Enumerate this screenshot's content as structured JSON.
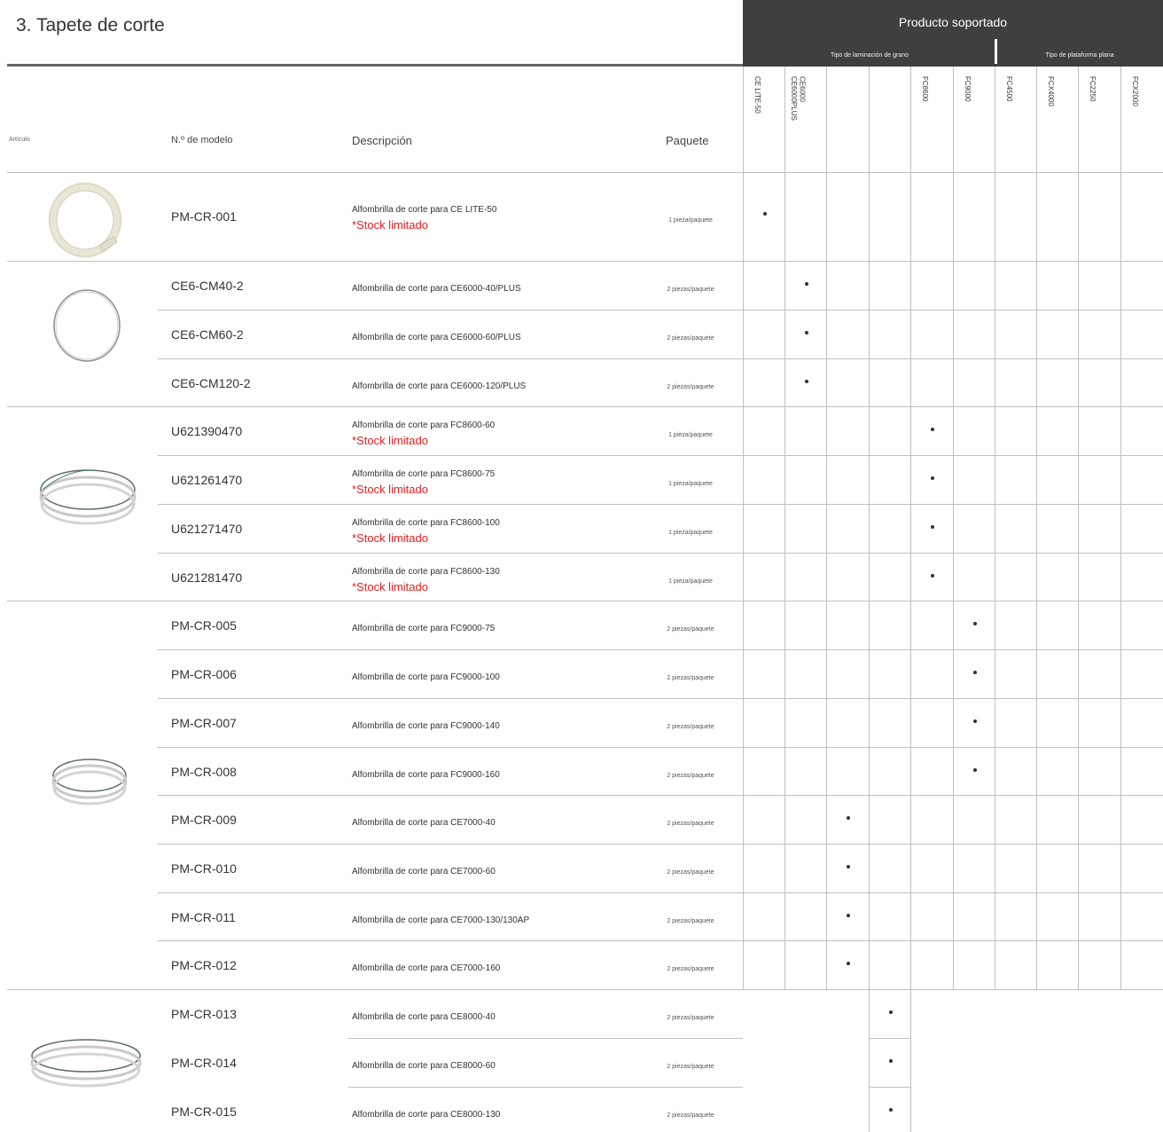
{
  "section_title": "3. Tapete de corte",
  "supported_header": {
    "title": "Producto soportado",
    "grain_label": "Tipo de laminación de grano",
    "flat_label": "Tipo de plataforma plana"
  },
  "columns": {
    "item": "Artículo",
    "model": "N.º de modelo",
    "description": "Descripción",
    "package": "Paquete"
  },
  "products": [
    "CE LITE-50",
    "CE6000\nCE6000PLUS",
    "",
    "",
    "FC8600",
    "FC9000",
    "FC4500",
    "FCX4000",
    "FC2250",
    "FCX2000"
  ],
  "product_labels": [
    "CE LITE-50",
    "CE6000 CE6000PLUS",
    "",
    "",
    "FC8600",
    "FC9000",
    "FC4500",
    "FCX4000",
    "FC2250",
    "FCX2000"
  ],
  "rows": [
    {
      "model": "PM-CR-001",
      "desc": "Alfombrilla de corte para CE LITE-50",
      "note": "*Stock limitado",
      "pack": "1 pieza/paquete",
      "col": 0
    },
    {
      "model": "CE6-CM40-2",
      "desc": "Alfombrilla de corte para CE6000-40/PLUS",
      "note": "",
      "pack": "2 piezas/paquete",
      "col": 1
    },
    {
      "model": "CE6-CM60-2",
      "desc": "Alfombrilla de corte para CE6000-60/PLUS",
      "note": "",
      "pack": "2 piezas/paquete",
      "col": 1
    },
    {
      "model": "CE6-CM120-2",
      "desc": "Alfombrilla de corte para CE6000-120/PLUS",
      "note": "",
      "pack": "2 piezas/paquete",
      "col": 1
    },
    {
      "model": "U621390470",
      "desc": "Alfombrilla de corte para FC8600-60",
      "note": "*Stock limitado",
      "pack": "1 pieza/paquete",
      "col": 4
    },
    {
      "model": "U621261470",
      "desc": "Alfombrilla de corte para FC8600-75",
      "note": "*Stock limitado",
      "pack": "1 pieza/paquete",
      "col": 4
    },
    {
      "model": "U621271470",
      "desc": "Alfombrilla de corte para FC8600-100",
      "note": "*Stock limitado",
      "pack": "1 pieza/paquete",
      "col": 4
    },
    {
      "model": "U621281470",
      "desc": "Alfombrilla de corte para FC8600-130",
      "note": "*Stock limitado",
      "pack": "1 pieza/paquete",
      "col": 4
    },
    {
      "model": "PM-CR-005",
      "desc": "Alfombrilla de corte para FC9000-75",
      "note": "",
      "pack": "2 piezas/paquete",
      "col": 5
    },
    {
      "model": "PM-CR-006",
      "desc": "Alfombrilla de corte para FC9000-100",
      "note": "",
      "pack": "2 piezas/paquete",
      "col": 5
    },
    {
      "model": "PM-CR-007",
      "desc": "Alfombrilla de corte para FC9000-140",
      "note": "",
      "pack": "2 piezas/paquete",
      "col": 5
    },
    {
      "model": "PM-CR-008",
      "desc": "Alfombrilla de corte para FC9000-160",
      "note": "",
      "pack": "2 piezas/paquete",
      "col": 5
    },
    {
      "model": "PM-CR-009",
      "desc": "Alfombrilla de corte para CE7000-40",
      "note": "",
      "pack": "2 piezas/paquete",
      "col": 2
    },
    {
      "model": "PM-CR-010",
      "desc": "Alfombrilla de corte para CE7000-60",
      "note": "",
      "pack": "2 piezas/paquete",
      "col": 2
    },
    {
      "model": "PM-CR-011",
      "desc": "Alfombrilla de corte para CE7000-130/130AP",
      "note": "",
      "pack": "2 piezas/paquete",
      "col": 2
    },
    {
      "model": "PM-CR-012",
      "desc": "Alfombrilla de corte para CE7000-160",
      "note": "",
      "pack": "2 piezas/paquete",
      "col": 2
    },
    {
      "model": "PM-CR-013",
      "desc": "Alfombrilla de corte para CE8000-40",
      "note": "",
      "pack": "2 piezas/paquete",
      "col": 3
    },
    {
      "model": "PM-CR-014",
      "desc": "Alfombrilla de corte para CE8000-60",
      "note": "",
      "pack": "2 piezas/paquete",
      "col": 3
    },
    {
      "model": "PM-CR-015",
      "desc": "Alfombrilla de corte para CE8000-130",
      "note": "",
      "pack": "2 piezas/paquete",
      "col": 3
    }
  ],
  "images": [
    "cutting-mat-white-coil",
    "cutting-mat-thin-ring",
    "cutting-mat-steel-coil",
    "cutting-mat-steel-coil",
    "cutting-mat-steel-coil"
  ]
}
